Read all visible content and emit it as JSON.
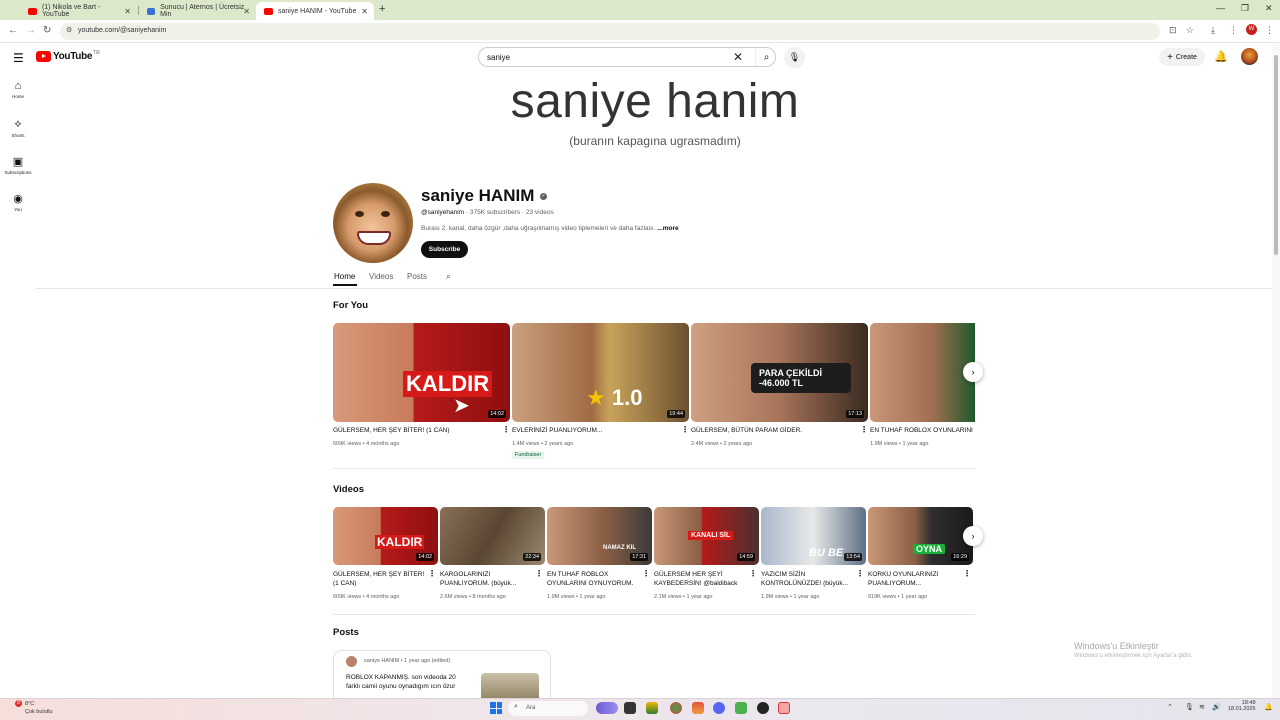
{
  "browser": {
    "tabs": [
      {
        "label": "(1) Nikola ve Bart - YouTube",
        "color": "#ff0000"
      },
      {
        "label": "Sunucu | Aternos | Ücretsiz Min",
        "color": "#3b6fd8"
      },
      {
        "label": "saniye HANIM - YouTube",
        "color": "#ff0000"
      }
    ],
    "url": "youtube.com/@saniyehanim",
    "profile_initial": "W"
  },
  "yt": {
    "logo_text": "YouTube",
    "logo_country": "TR",
    "search": {
      "value": "saniye",
      "placeholder": "Search"
    },
    "create_label": "Create",
    "rail": [
      {
        "icon": "home-icon",
        "label": "Home"
      },
      {
        "icon": "shorts-icon",
        "label": "Shorts"
      },
      {
        "icon": "subscriptions-icon",
        "label": "Subscriptions"
      },
      {
        "icon": "you-icon",
        "label": "You"
      }
    ]
  },
  "banner": {
    "title": "saniye hanim",
    "subtitle": "(buranın kapagına ugrasmadım)"
  },
  "channel": {
    "name": "saniye HANIM",
    "handle": "@saniyehanim",
    "subscribers": "375K subscribers",
    "videos_count": "23 videos",
    "description": "Burası 2. kanal, daha özgür ,daha uğraşılmamış video tiplemeleri ve daha fazlası.",
    "more_label": "...more",
    "subscribe_label": "Subscribe",
    "tabs": [
      "Home",
      "Videos",
      "Posts"
    ],
    "active_tab": "Home"
  },
  "for_you": {
    "title": "For You",
    "items": [
      {
        "title": "GÜLERSEM, HER ŞEY BİTER! (1 CAN)",
        "views": "609K views",
        "age": "4 months ago",
        "duration": "14:02",
        "caption": "KALDIR",
        "bg": "#b51a1a"
      },
      {
        "title": "EVLERİNİZİ PUANLIYORUM...",
        "views": "1.4M views",
        "age": "2 years ago",
        "duration": "19:44",
        "caption": "1.0",
        "bg": "#7a4d2c",
        "badge": "Fundraiser"
      },
      {
        "title": "GÜLERSEM, BÜTÜN PARAM GİDER.",
        "views": "2.4M views",
        "age": "2 years ago",
        "duration": "17:13",
        "caption": "PARA ÇEKİLDİ -46.000 TL",
        "bg": "#2a2a2a"
      },
      {
        "title": "EN TUHAF ROBLOX OYUNLARINI",
        "views": "1.9M views",
        "age": "1 year ago",
        "duration": "",
        "caption": "",
        "bg": "#3a3a3a"
      }
    ]
  },
  "videos": {
    "title": "Videos",
    "items": [
      {
        "title": "GÜLERSEM, HER ŞEY BİTER! (1 CAN)",
        "views": "609K views",
        "age": "4 months ago",
        "duration": "14:02",
        "caption": "KALDIR",
        "bg": "#b51a1a"
      },
      {
        "title": "KARGOLARINIZI PUANLIYORUM. (büyük...",
        "views": "2.6M views",
        "age": "8 months ago",
        "duration": "22:34",
        "caption": "",
        "bg": "#5a4632"
      },
      {
        "title": "EN TUHAF ROBLOX OYUNLARINI OYNUYORUM.",
        "views": "1.9M views",
        "age": "1 year ago",
        "duration": "17:31",
        "caption": "NAMAZ KIL",
        "bg": "#3a3a3a"
      },
      {
        "title": "GÜLERSEM HER ŞEYİ KAYBEDERSİN! @baldiback",
        "views": "2.1M views",
        "age": "1 year ago",
        "duration": "14:59",
        "caption": "KANALI SİL",
        "bg": "#4a3030"
      },
      {
        "title": "YAZICIM SİZİN KONTROLÜNÜZDE! (büyük...",
        "views": "1.9M views",
        "age": "1 year ago",
        "duration": "13:54",
        "caption": "BU BE",
        "bg": "#5d6f86"
      },
      {
        "title": "KORKU OYUNLARINIZI PUANLIYORUM...",
        "views": "919K views",
        "age": "1 year ago",
        "duration": "16:29",
        "caption": "OYNA",
        "bg": "#2e2e2e"
      }
    ]
  },
  "posts": {
    "title": "Posts",
    "author": "saniye HANIM",
    "age": "1 year ago (edited)",
    "body": "ROBLOX KAPANMIŞ. son videoda 20 farklı camii oyunu oynadıgım ıcın özur"
  },
  "watermark": {
    "title": "Windows'u Etkinleştir",
    "subtitle": "Windows'u etkinleştirmek için Ayarlar'a gidin."
  },
  "taskbar": {
    "weather_badge": "8",
    "temperature": "8°C",
    "weather_desc": "Çok bulutlu",
    "search_label": "Ara",
    "time": "18:48",
    "date": "18.01.2026"
  }
}
